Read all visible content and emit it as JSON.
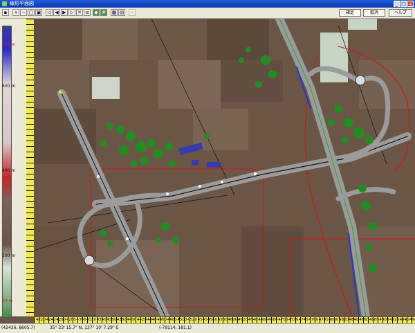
{
  "window": {
    "title": "線形平面図"
  },
  "titlebar_buttons": [
    "_",
    "□",
    "×"
  ],
  "dialog_buttons": {
    "ok": "確定",
    "cancel": "取消",
    "help": "ヘルプ"
  },
  "legend": {
    "labels": [
      {
        "text": "700 m",
        "color": "red"
      },
      {
        "text": "600 m",
        "color": "normal"
      },
      {
        "text": "400 m",
        "color": "normal"
      },
      {
        "text": "200 m",
        "color": "normal"
      },
      {
        "text": "90 m",
        "color": "red"
      }
    ]
  },
  "ruler_x": {
    "labels": [
      "4220",
      "4240",
      "4260",
      "4280",
      "4300",
      "4320",
      "4340",
      "4360",
      "4380",
      "4400",
      "4420",
      "4440",
      "4460",
      "4480",
      "4500",
      "4520",
      "4540",
      "4560",
      "4580",
      "4600",
      "4620",
      "4640",
      "4660",
      "4680",
      "4700",
      "4720",
      "4740",
      "4760",
      "4780",
      "4800",
      "4820",
      "4840",
      "4860",
      "4880",
      "4900",
      "4920",
      "4940",
      "4960"
    ]
  },
  "status": {
    "coords": "(42436, 8605.7)",
    "lat": "35° 23' 15.7\" N, 137° 10' 7.29\" E",
    "world": "(-79114, 181.1)"
  },
  "colors": {
    "terrain": "#6b5646",
    "road": "#9a9a9a",
    "vegetation": "#1e8e1e",
    "boundary": "#d11"
  }
}
